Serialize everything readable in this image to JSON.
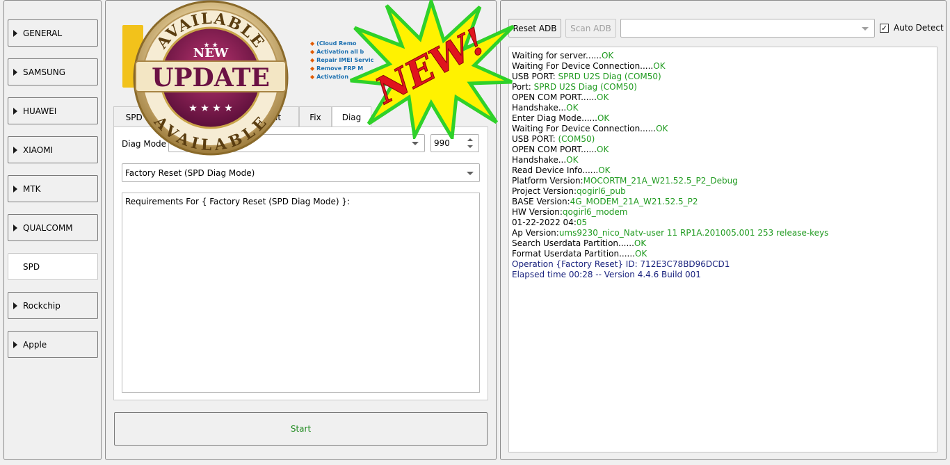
{
  "sidebar": {
    "items": [
      {
        "label": "GENERAL",
        "active": false
      },
      {
        "label": "SAMSUNG",
        "active": false
      },
      {
        "label": "HUAWEI",
        "active": false
      },
      {
        "label": "XIAOMI",
        "active": false
      },
      {
        "label": "MTK",
        "active": false
      },
      {
        "label": "QUALCOMM",
        "active": false
      },
      {
        "label": "SPD",
        "active": true
      },
      {
        "label": "Rockchip",
        "active": false
      },
      {
        "label": "Apple",
        "active": false
      }
    ]
  },
  "tabs": [
    {
      "label": "SPD F"
    },
    {
      "label": "at"
    },
    {
      "label": "Fix"
    },
    {
      "label": "Diag",
      "active": true
    }
  ],
  "diag": {
    "mode_label": "Diag Mode",
    "mode_value": "",
    "baud_value": "990",
    "operation_value": "Factory Reset (SPD Diag Mode)",
    "requirements_text": "Requirements For { Factory Reset (SPD Diag Mode) }:"
  },
  "start_label": "Start",
  "toolbar": {
    "reset_adb": "Reset ADB",
    "scan_adb": "Scan ADB",
    "device_value": "",
    "auto_detect": "Auto Detect",
    "auto_detect_checked": true
  },
  "promo": {
    "lines": [
      "(Cloud Remo",
      "Activation all b",
      "Repair IMEI Servic",
      "Remove FRP M",
      "Activation "
    ],
    "badge_top": "AVAILABLE",
    "badge_new": "NEW",
    "badge_main": "UPDATE",
    "badge_bottom": "AVAILABLE",
    "burst_text": "NEW!"
  },
  "log": [
    {
      "text": "Waiting for server......",
      "status": "OK"
    },
    {
      "text": "Waiting For Device Connection.....",
      "status": "OK"
    },
    {
      "text": "USB PORT: ",
      "status": "SPRD U2S Diag (COM50)"
    },
    {
      "text": "Port: ",
      "status": "SPRD U2S Diag (COM50)"
    },
    {
      "text": "OPEN COM PORT......",
      "status": "OK"
    },
    {
      "text": "Handshake...",
      "status": "OK"
    },
    {
      "text": "Enter Diag Mode......",
      "status": "OK"
    },
    {
      "text": "Waiting For Device Connection......",
      "status": "OK"
    },
    {
      "text": "USB PORT: ",
      "status": "(COM50)"
    },
    {
      "text": "OPEN COM PORT......",
      "status": "OK"
    },
    {
      "text": "Handshake...",
      "status": "OK"
    },
    {
      "text": "Read Device Info......",
      "status": "OK"
    },
    {
      "text": "Platform Version:",
      "status": "MOCORTM_21A_W21.52.5_P2_Debug"
    },
    {
      "text": "Project Version:",
      "status": "qogirl6_pub"
    },
    {
      "text": "BASE Version:",
      "status": "4G_MODEM_21A_W21.52.5_P2"
    },
    {
      "text": "HW Version:",
      "status": "qogirl6_modem"
    },
    {
      "text": "01-22-2022 04:",
      "status": "05"
    },
    {
      "text": "Ap Version:",
      "status": "ums9230_nico_Natv-user 11 RP1A.201005.001 253 release-keys"
    },
    {
      "text": "Search Userdata Partition......",
      "status": "OK"
    },
    {
      "text": "Format Userdata Partition......",
      "status": "OK"
    },
    {
      "text": "Operation {Factory Reset} ID: 712E3C78BD96DCD1",
      "status": "",
      "kind": "info"
    },
    {
      "text": "Elapsed time 00:28 -- Version 4.4.6 Build 001",
      "status": "",
      "kind": "info"
    }
  ],
  "colors": {
    "ok": "#1f9a1f",
    "info": "#1a237e",
    "badge_purple": "#8a1a5a",
    "badge_gold": "#c9a44a",
    "burst_yellow": "#fff200",
    "burst_red": "#e0141e"
  }
}
